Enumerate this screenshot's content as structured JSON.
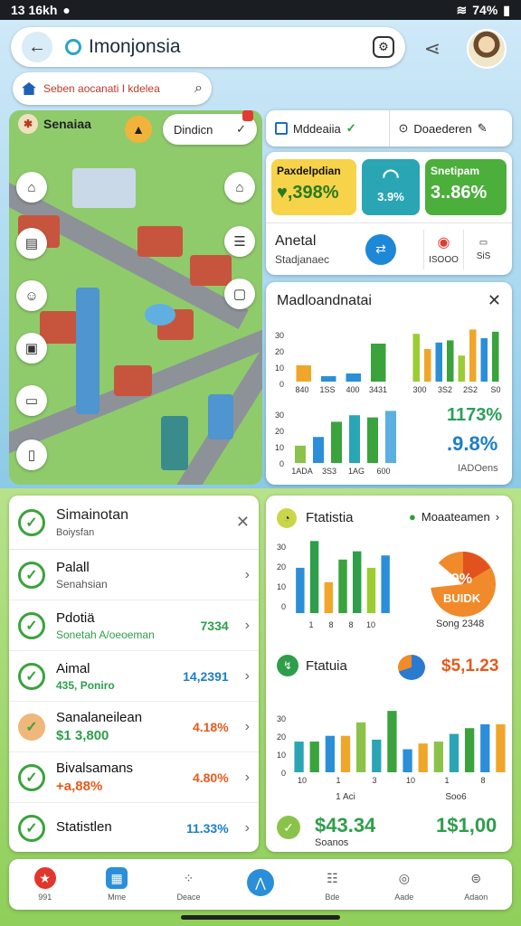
{
  "status": {
    "time": "13 16kh",
    "battery": "74%"
  },
  "header": {
    "title": "Imonjonsia",
    "search_placeholder": "Seben aocanati I kdelea"
  },
  "map": {
    "chip_label": "Senaiaa",
    "pill_label": "Dindicn"
  },
  "tabs": [
    {
      "label": "Mddeaiia"
    },
    {
      "label": "Doaederen"
    }
  ],
  "kpi": {
    "b1_label": "Paxdelpdian",
    "b1_value": "♥,398%",
    "b2_value": "3.9%",
    "b3_label": "Snetipam",
    "b3_value": "3..86%",
    "anetal_title": "Anetal",
    "anetal_sub": "Stadjanaec",
    "mini1": "ISOOO",
    "mini2": "SiS"
  },
  "chart1": {
    "title": "Madloandnatai",
    "left_ticks": [
      "30",
      "20",
      "10",
      "0"
    ],
    "left_x": [
      "840",
      "1SS",
      "400",
      "3431"
    ],
    "right_x": [
      "300",
      "3S2",
      "2S2",
      "S0"
    ],
    "low_ticks": [
      "30",
      "20",
      "10",
      "0"
    ],
    "low_x": [
      "1ADA",
      "3S3",
      "1AG",
      "600"
    ],
    "pct1": "1173%",
    "pct2": ".9.8%",
    "caption": "IADOens"
  },
  "list": {
    "title": "Simainotan",
    "subtitle": "Boiysfan",
    "rows": [
      {
        "title": "Palall",
        "sub": "Senahsian",
        "value": ""
      },
      {
        "title": "Pdotiä",
        "sub": "Sonetah A/oeoeman",
        "value": "7334"
      },
      {
        "title": "Aimal",
        "sub": "435, Poniro",
        "value": "14,2391"
      },
      {
        "title": "Sanalaneilean",
        "sub": "$1 3,800",
        "value": "4.18%"
      },
      {
        "title": "Bivalsamans",
        "sub": "+a,88%",
        "value": "4.80%"
      },
      {
        "title": "Statistlen",
        "sub": "",
        "value": "11.33%"
      }
    ]
  },
  "panel2": {
    "title": "Ftatistia",
    "link": "Moaateamen",
    "pie_label": "89%",
    "pie_sub": "BUIDK",
    "pie_caption": "Song 2348",
    "yticks": [
      "30",
      "20",
      "10",
      "0"
    ],
    "xticks": [
      "1",
      "8",
      "8",
      "10"
    ],
    "section2": "Ftatuia",
    "amount": "$5,1.23",
    "y2": [
      "30",
      "20",
      "10",
      "0"
    ],
    "x2": [
      "10",
      "1",
      "3",
      "10",
      "1",
      "8"
    ],
    "x2_caption": "1 Aci",
    "x2_right": "Soo6",
    "big1": "$43.34",
    "big1_sub": "Soanos",
    "big2": "1$1,00"
  },
  "nav": [
    {
      "label": "991"
    },
    {
      "label": "Mme"
    },
    {
      "label": "Deace"
    },
    {
      "label": ""
    },
    {
      "label": "Bde"
    },
    {
      "label": "Aade"
    },
    {
      "label": "Adaon"
    }
  ],
  "chart_data": [
    {
      "type": "bar",
      "title": "Madloandnatai",
      "categories": [
        "840",
        "1SS",
        "400",
        "3431"
      ],
      "series": [
        {
          "values": [
            6,
            2,
            3,
            14
          ]
        }
      ]
    },
    {
      "type": "bar",
      "categories": [
        "1ADA",
        "3S3",
        "1AG",
        "600"
      ],
      "series": [
        {
          "values": [
            8,
            12,
            19,
            22
          ]
        }
      ]
    },
    {
      "type": "bar",
      "title": "Ftatistia",
      "categories": [
        "1",
        "8",
        "8",
        "10"
      ],
      "series": [
        {
          "values": [
            22,
            35,
            15,
            26
          ]
        }
      ]
    },
    {
      "type": "pie",
      "series": [
        {
          "values": [
            89,
            11
          ]
        }
      ]
    }
  ]
}
